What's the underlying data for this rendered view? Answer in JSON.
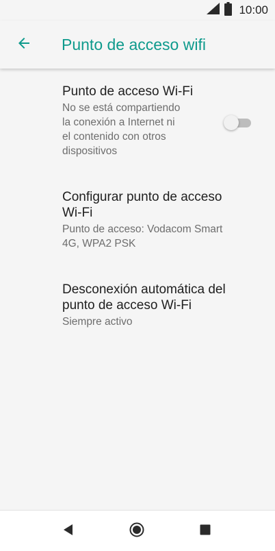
{
  "status_bar": {
    "time": "10:00",
    "icons": [
      "signal-icon",
      "battery-icon"
    ]
  },
  "app_bar": {
    "back_icon": "arrow-left-icon",
    "title": "Punto de acceso wifi",
    "accent_color": "#0e9a8c"
  },
  "preferences": [
    {
      "title": "Punto de acceso Wi-Fi",
      "summary_lines": [
        "No se está compartiendo",
        "la conexión a Internet ni",
        "el contenido con otros",
        "dispositivos"
      ],
      "toggle_on": false
    },
    {
      "title_lines": [
        "Configurar punto de acceso",
        "Wi-Fi"
      ],
      "summary_lines": [
        "Punto de acceso: Vodacom Smart",
        "4G, WPA2 PSK"
      ]
    },
    {
      "title_lines": [
        "Desconexión automática del",
        "punto de acceso Wi-Fi"
      ],
      "summary_lines": [
        "Siempre activo"
      ]
    }
  ],
  "nav_bar": {
    "back_icon": "triangle-back-icon",
    "home_icon": "circle-home-icon",
    "recents_icon": "square-recents-icon"
  }
}
